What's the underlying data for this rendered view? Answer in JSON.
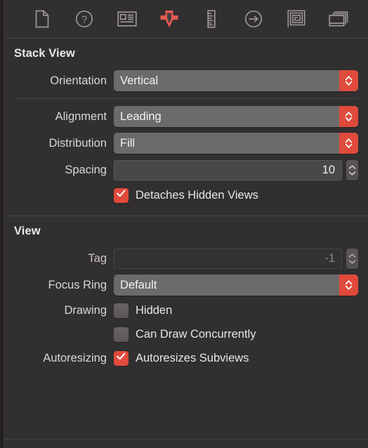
{
  "toolbar": {
    "items": [
      {
        "name": "file-inspector",
        "icon": "document-icon",
        "selected": false
      },
      {
        "name": "quick-help-inspector",
        "icon": "question-circle-icon",
        "selected": false
      },
      {
        "name": "identity-inspector",
        "icon": "identity-card-icon",
        "selected": false
      },
      {
        "name": "attributes-inspector",
        "icon": "attributes-arrow-icon",
        "selected": true
      },
      {
        "name": "size-inspector",
        "icon": "ruler-icon",
        "selected": false
      },
      {
        "name": "connections-inspector",
        "icon": "arrow-circle-right-icon",
        "selected": false
      },
      {
        "name": "bindings-inspector",
        "icon": "spiral-icon",
        "selected": false
      },
      {
        "name": "view-effects-inspector",
        "icon": "layers-icon",
        "selected": false
      }
    ]
  },
  "colors": {
    "accent": "#e04a3b",
    "panel_background": "#322f30",
    "control_gray": "#6d6a6b",
    "text": "#dcdcdc"
  },
  "stack_view": {
    "header": "Stack View",
    "orientation": {
      "label": "Orientation",
      "value": "Vertical"
    },
    "alignment": {
      "label": "Alignment",
      "value": "Leading"
    },
    "distribution": {
      "label": "Distribution",
      "value": "Fill"
    },
    "spacing": {
      "label": "Spacing",
      "value": "10"
    },
    "detaches_hidden_views": {
      "label": "Detaches Hidden Views",
      "checked": true
    }
  },
  "view": {
    "header": "View",
    "tag": {
      "label": "Tag",
      "value": "-1",
      "disabled": true
    },
    "focus_ring": {
      "label": "Focus Ring",
      "value": "Default"
    },
    "drawing": {
      "label": "Drawing",
      "hidden": {
        "label": "Hidden",
        "checked": false
      },
      "can_draw_concurrently": {
        "label": "Can Draw Concurrently",
        "checked": false
      }
    },
    "autoresizing": {
      "label": "Autoresizing",
      "autoresizes_subviews": {
        "label": "Autoresizes Subviews",
        "checked": true
      }
    }
  }
}
